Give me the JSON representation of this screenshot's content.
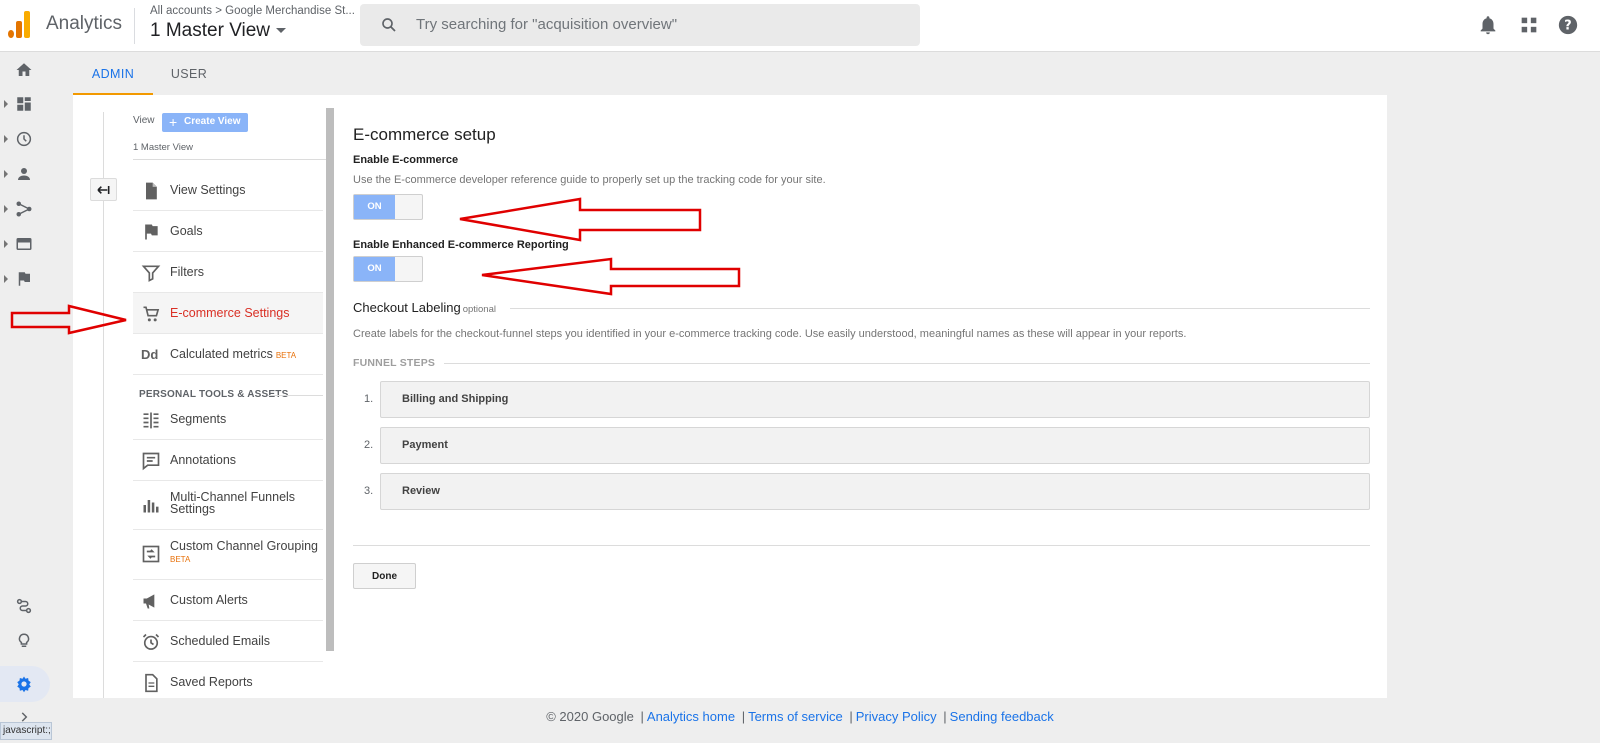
{
  "header": {
    "app_title": "Analytics",
    "breadcrumb_root": "All accounts",
    "breadcrumb_sep": ">",
    "breadcrumb_account": "Google Merchandise St...",
    "view_name": "1 Master View",
    "search_placeholder": "Try searching for \"acquisition overview\""
  },
  "tabs": [
    {
      "label": "ADMIN",
      "active": true
    },
    {
      "label": "USER",
      "active": false
    }
  ],
  "view_column": {
    "view_label": "View",
    "create_view_label": "Create View",
    "create_view_icon": "+",
    "current_view": "1 Master View",
    "items": [
      {
        "label": "View Settings",
        "icon": "document-icon"
      },
      {
        "label": "Goals",
        "icon": "flag-icon"
      },
      {
        "label": "Filters",
        "icon": "filter-icon"
      },
      {
        "label": "E-commerce Settings",
        "icon": "cart-icon",
        "active": true
      },
      {
        "label": "Calculated metrics",
        "icon": "dd-icon",
        "badge": "BETA"
      }
    ],
    "section_title": "PERSONAL TOOLS & ASSETS",
    "personal_items": [
      {
        "label": "Segments",
        "icon": "segments-icon"
      },
      {
        "label": "Annotations",
        "icon": "annotation-icon"
      },
      {
        "label": "Multi-Channel Funnels Settings",
        "icon": "bar-chart-icon"
      },
      {
        "label": "Custom Channel Grouping",
        "icon": "channel-grouping-icon",
        "badge": "BETA"
      },
      {
        "label": "Custom Alerts",
        "icon": "megaphone-icon"
      },
      {
        "label": "Scheduled Emails",
        "icon": "alarm-icon"
      },
      {
        "label": "Saved Reports",
        "icon": "report-icon"
      }
    ]
  },
  "settings": {
    "title": "E-commerce setup",
    "enable_ecommerce_label": "Enable E-commerce",
    "enable_ecommerce_help": "Use the E-commerce developer reference guide to properly set up the tracking code for your site.",
    "enable_ecommerce_state": "ON",
    "enhanced_label": "Enable Enhanced E-commerce Reporting",
    "enhanced_state": "ON",
    "checkout_title": "Checkout Labeling",
    "checkout_optional": "optional",
    "checkout_help": "Create labels for the checkout-funnel steps you identified in your e-commerce tracking code. Use easily understood, meaningful names as these will appear in your reports.",
    "funnel_title": "FUNNEL STEPS",
    "steps": [
      {
        "num": "1.",
        "name": "Billing and Shipping"
      },
      {
        "num": "2.",
        "name": "Payment"
      },
      {
        "num": "3.",
        "name": "Review"
      }
    ],
    "done_label": "Done"
  },
  "footer": {
    "copyright": "© 2020 Google",
    "sep": "|",
    "links": [
      "Analytics home",
      "Terms of service",
      "Privacy Policy",
      "Sending feedback"
    ]
  },
  "status_tooltip": "javascript:;",
  "colors": {
    "accent_blue": "#1a73e8",
    "active_red": "#d93025",
    "toggle_on": "#8ab4f8",
    "tab_underline": "#f29900",
    "annotation_arrow": "#e00000"
  }
}
